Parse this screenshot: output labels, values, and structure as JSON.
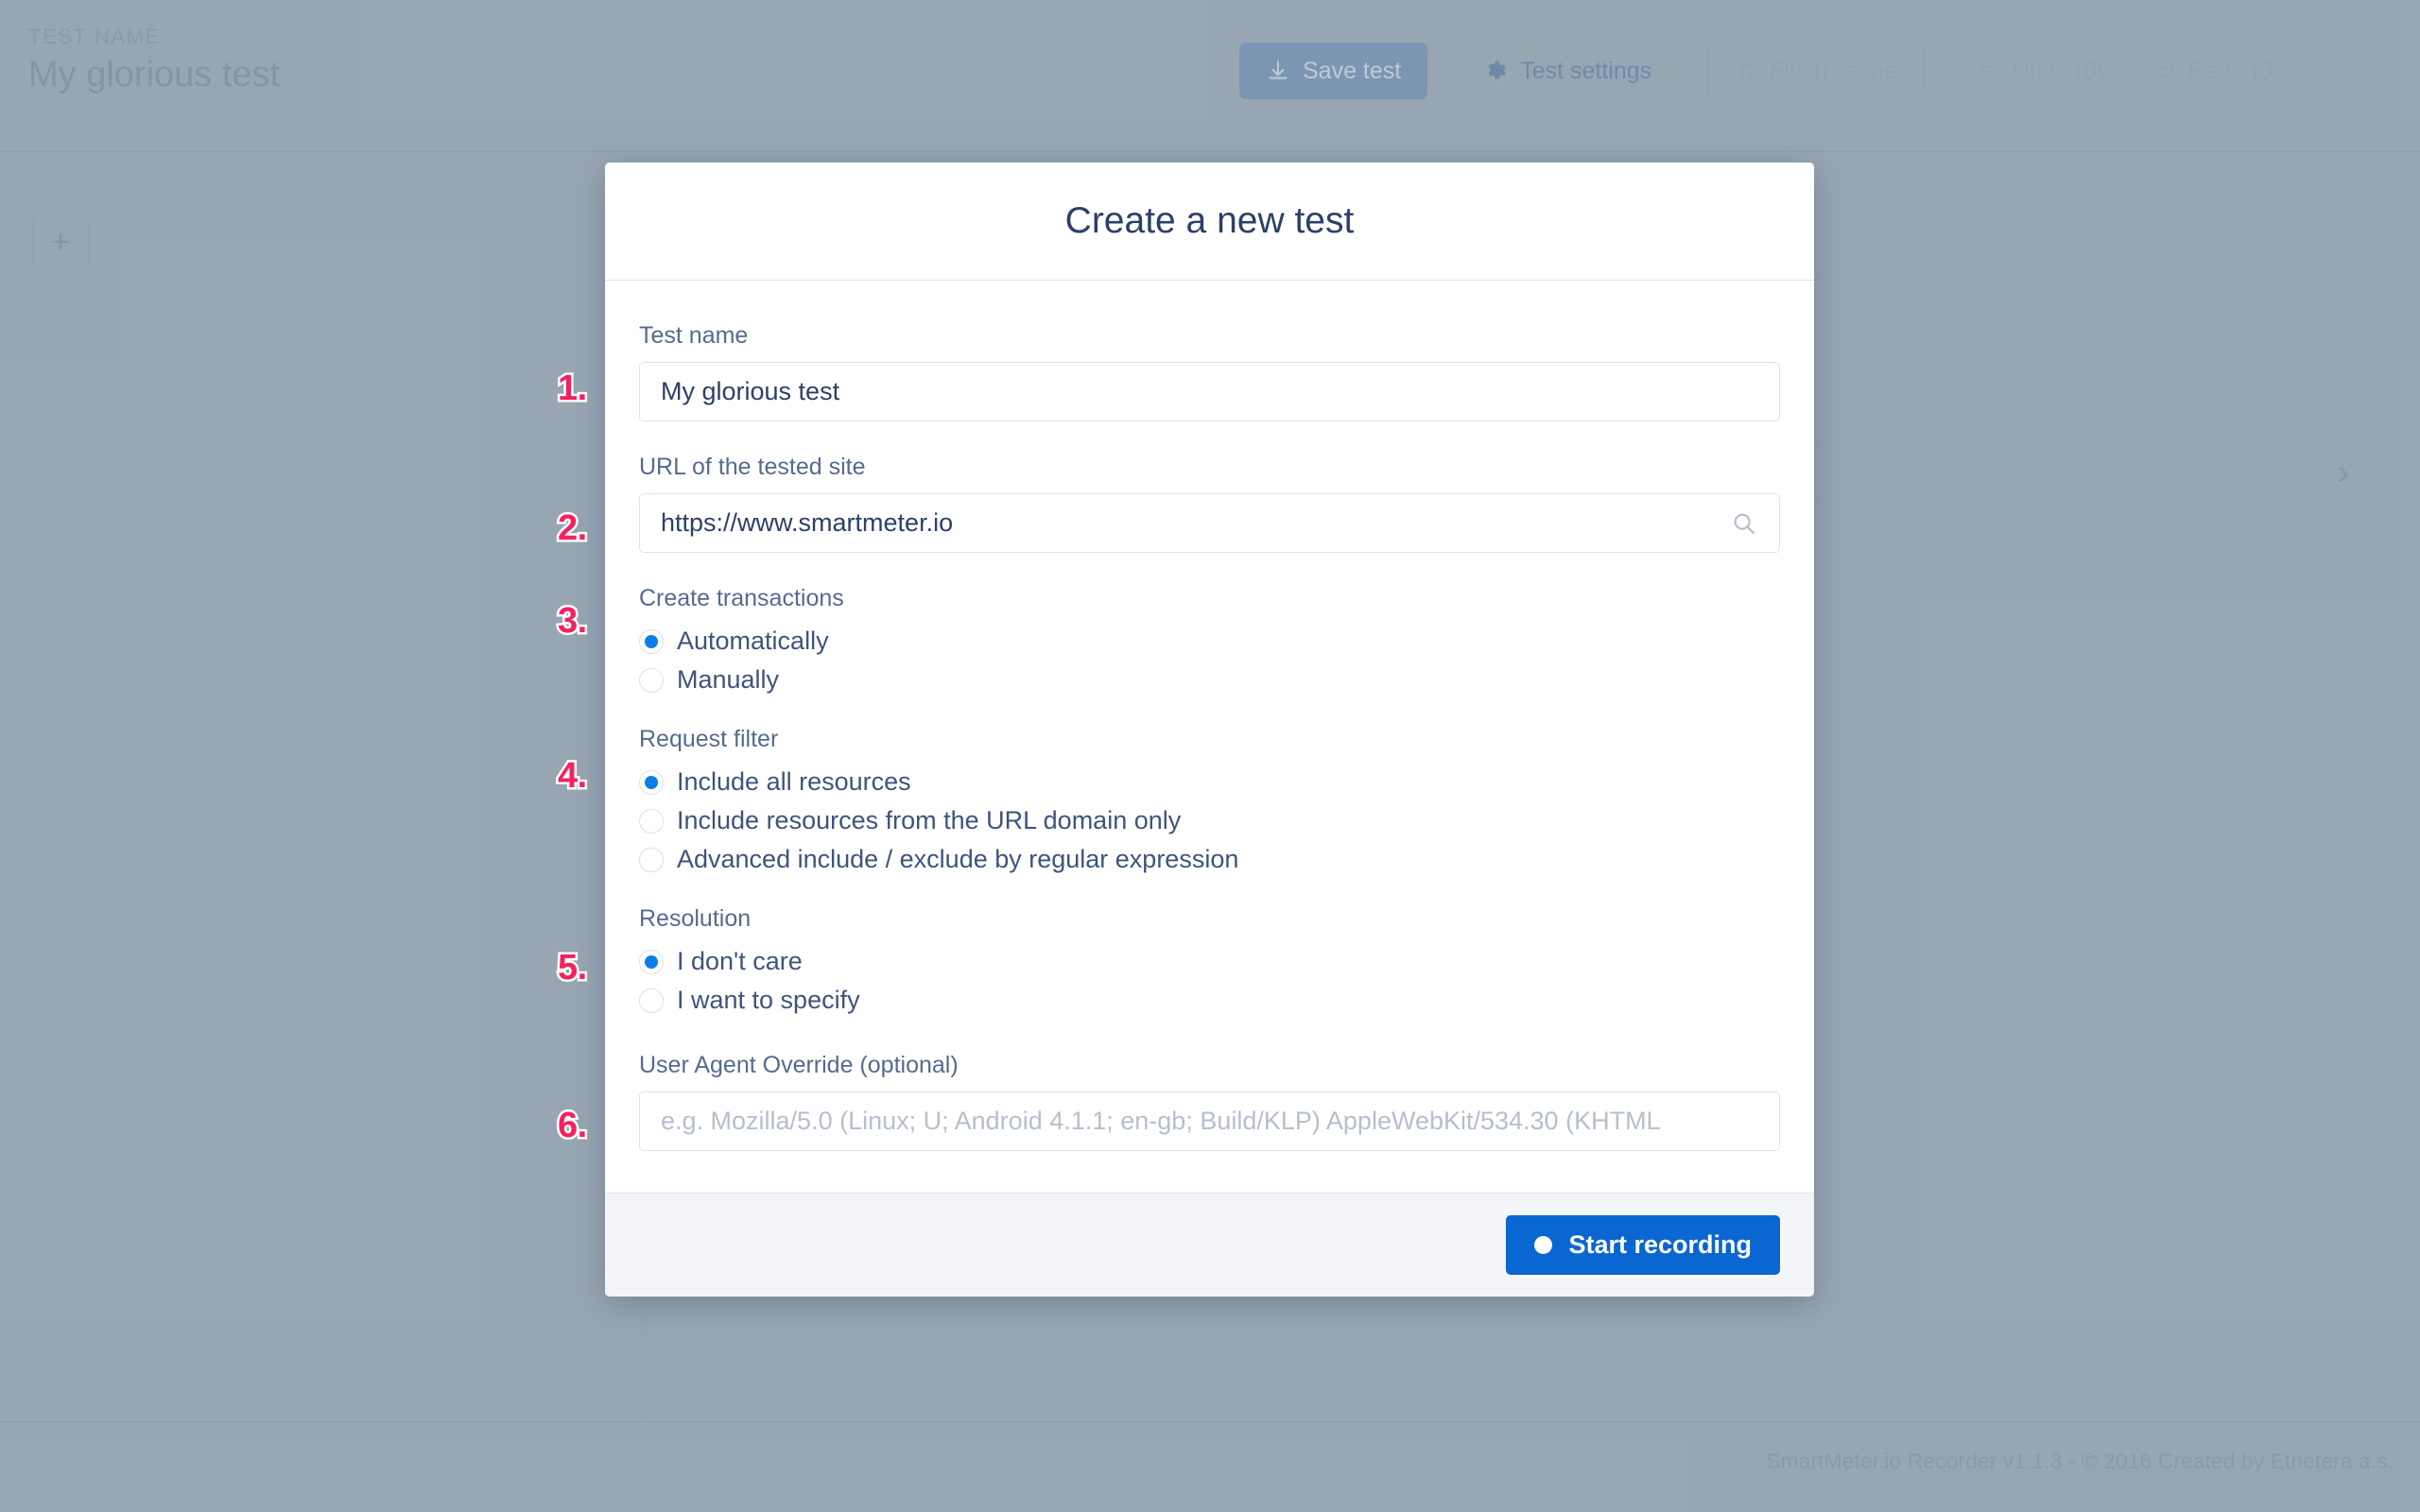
{
  "app": {
    "topbar": {
      "eyebrow": "TEST NAME",
      "test_name": "My glorious test",
      "save_label": "Save test",
      "settings_label": "Test settings",
      "flush_label": "Flush cache",
      "undo_label": "Undo (0)",
      "redo_label": "Redo (0)"
    },
    "canvas": {
      "add_step_label": "+",
      "chevron_label": "›"
    },
    "footer": {
      "text": "SmartMeter.io Recorder v1.1.3 - © 2016 Created by Etnetera a.s."
    }
  },
  "modal": {
    "title": "Create a new test",
    "fields": {
      "test_name": {
        "label": "Test name",
        "value": "My glorious test"
      },
      "url": {
        "label": "URL of the tested site",
        "value": "https://www.smartmeter.io"
      },
      "create_transactions": {
        "label": "Create transactions",
        "options": [
          {
            "label": "Automatically",
            "checked": true
          },
          {
            "label": "Manually",
            "checked": false
          }
        ]
      },
      "request_filter": {
        "label": "Request filter",
        "options": [
          {
            "label": "Include all resources",
            "checked": true
          },
          {
            "label": "Include resources from the URL domain only",
            "checked": false
          },
          {
            "label": "Advanced include / exclude by regular expression",
            "checked": false
          }
        ]
      },
      "resolution": {
        "label": "Resolution",
        "options": [
          {
            "label": "I don't care",
            "checked": true
          },
          {
            "label": "I want to specify",
            "checked": false
          }
        ]
      },
      "user_agent": {
        "label": "User Agent Override (optional)",
        "value": "",
        "placeholder": "e.g. Mozilla/5.0 (Linux; U; Android 4.1.1; en-gb; Build/KLP) AppleWebKit/534.30 (KHTML"
      }
    },
    "footer": {
      "start_label": "Start recording"
    }
  },
  "step_badges": [
    {
      "label": "1."
    },
    {
      "label": "2."
    },
    {
      "label": "3."
    },
    {
      "label": "4."
    },
    {
      "label": "5."
    },
    {
      "label": "6."
    }
  ],
  "colors": {
    "accent_blue": "#0b7ee6",
    "button_blue": "#0a66d0",
    "badge_pink": "#f5215f",
    "background_gray": "#9aa7b5",
    "text_navy": "#2d4069"
  }
}
